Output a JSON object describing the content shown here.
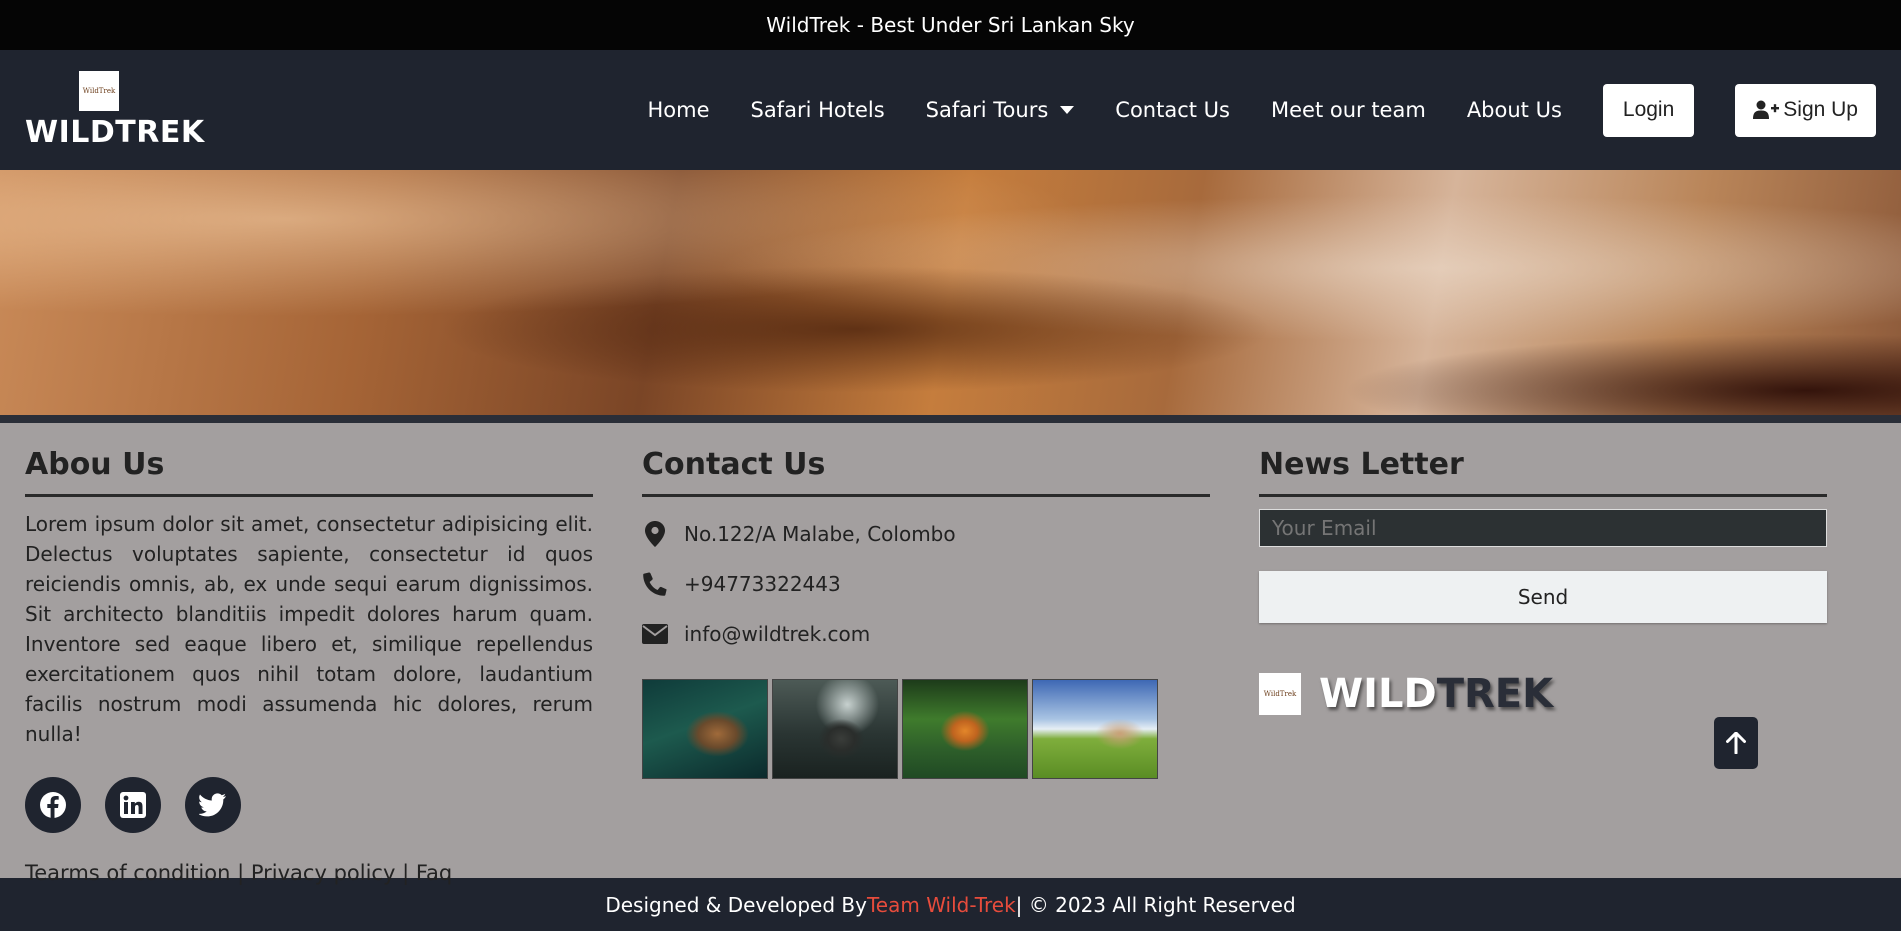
{
  "topbar": {
    "text": "WildTrek - Best Under Sri Lankan Sky"
  },
  "brand": {
    "logo_text": "WildTrek",
    "name": "WILDTREK"
  },
  "nav": {
    "items": [
      "Home",
      "Safari Hotels",
      "Safari Tours",
      "Contact Us",
      "Meet our team",
      "About Us"
    ],
    "login_label": "Login",
    "signup_label": "Sign Up"
  },
  "footer": {
    "about": {
      "title": "Abou Us",
      "text": "Lorem ipsum dolor sit amet, consectetur adipisicing elit. Delectus voluptates sapiente, consectetur id quos reiciendis omnis, ab, ex unde sequi earum dignissimos. Sit architecto blanditiis impedit dolores harum quam. Inventore sed eaque libero et, similique repellendus exercitationem quos nihil totam dolore, laudantium facilis nostrum modi assumenda hic dolores, rerum nulla!",
      "socials": [
        "facebook",
        "linkedin",
        "twitter"
      ],
      "legal": [
        "Tearms of condition",
        "Privacy policy",
        "Faq"
      ],
      "legal_sep": "|"
    },
    "contact": {
      "title": "Contact Us",
      "address": "No.122/A Malabe, Colombo",
      "phone": "+94773322443",
      "email": "info@wildtrek.com"
    },
    "newsletter": {
      "title": "News Letter",
      "placeholder": "Your Email",
      "send_label": "Send",
      "brand_logo_text": "WildTrek",
      "brand_wild": "WILD",
      "brand_trek": "TREK"
    }
  },
  "bottombar": {
    "prefix": "Designed & Developed By ",
    "team": "Team Wild-Trek",
    "suffix": " | © 2023 All Right Reserved"
  },
  "colors": {
    "dark_navy": "#1f242f",
    "footer_bg": "#a39f9f",
    "accent_red": "#e74c3c"
  },
  "icons": {
    "caret": "caret-down-icon",
    "signup": "user-plus-icon",
    "address": "map-marker-icon",
    "phone": "phone-icon",
    "email": "envelope-icon",
    "to_top": "arrow-up-icon"
  }
}
